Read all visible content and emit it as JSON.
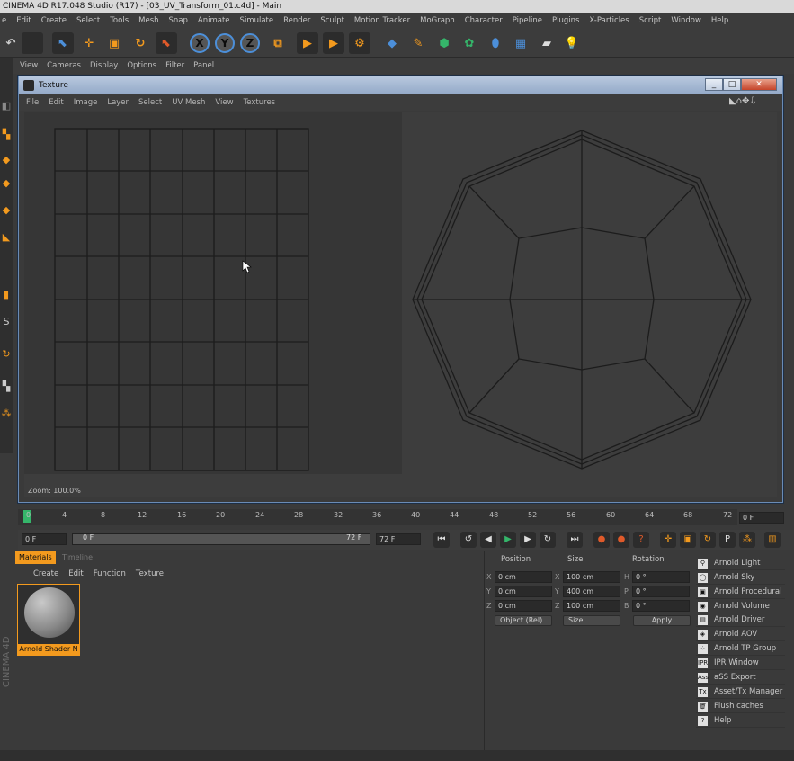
{
  "app": {
    "title": "CINEMA 4D R17.048 Studio (R17) - [03_UV_Transform_01.c4d] - Main",
    "brand": "CINEMA 4D"
  },
  "menubar": [
    "e",
    "Edit",
    "Create",
    "Select",
    "Tools",
    "Mesh",
    "Snap",
    "Animate",
    "Simulate",
    "Render",
    "Sculpt",
    "Motion Tracker",
    "MoGraph",
    "Character",
    "Pipeline",
    "Plugins",
    "X-Particles",
    "Script",
    "Window",
    "Help"
  ],
  "viewport_menu": [
    "View",
    "Cameras",
    "Display",
    "Options",
    "Filter",
    "Panel"
  ],
  "texture_window": {
    "title": "Texture",
    "menu": [
      "File",
      "Edit",
      "Image",
      "Layer",
      "Select",
      "UV Mesh",
      "View",
      "Textures"
    ],
    "zoom": "Zoom: 100.0%"
  },
  "timeline": {
    "ticks": [
      "0",
      "4",
      "8",
      "12",
      "16",
      "20",
      "24",
      "28",
      "32",
      "36",
      "40",
      "44",
      "48",
      "52",
      "56",
      "60",
      "64",
      "68",
      "72"
    ],
    "end_frame": "0 F"
  },
  "transport": {
    "current": "0 F",
    "start": "0 F",
    "end": "72 F",
    "max": "72 F"
  },
  "materials": {
    "tabs": [
      "Materials",
      "Timeline"
    ],
    "menu": [
      "Create",
      "Edit",
      "Function",
      "Texture"
    ],
    "items": [
      {
        "name": "Arnold Shader N"
      }
    ]
  },
  "attributes": {
    "headers": [
      "Position",
      "Size",
      "Rotation"
    ],
    "rows": [
      {
        "axis": "X",
        "pos": "0 cm",
        "size_axis": "X",
        "size": "100 cm",
        "rot_axis": "H",
        "rot": "0 °"
      },
      {
        "axis": "Y",
        "pos": "0 cm",
        "size_axis": "Y",
        "size": "400 cm",
        "rot_axis": "P",
        "rot": "0 °"
      },
      {
        "axis": "Z",
        "pos": "0 cm",
        "size_axis": "Z",
        "size": "100 cm",
        "rot_axis": "B",
        "rot": "0 °"
      }
    ],
    "coord_mode": "Object (Rel)",
    "size_mode": "Size",
    "apply": "Apply"
  },
  "arnold_menu": [
    {
      "icon": "lightbulb-icon",
      "glyph": "⚲",
      "label": "Arnold Light"
    },
    {
      "icon": "sky-icon",
      "glyph": "◯",
      "label": "Arnold Sky"
    },
    {
      "icon": "procedural-icon",
      "glyph": "▣",
      "label": "Arnold Procedural"
    },
    {
      "icon": "volume-icon",
      "glyph": "◉",
      "label": "Arnold Volume"
    },
    {
      "icon": "driver-icon",
      "glyph": "▤",
      "label": "Arnold Driver"
    },
    {
      "icon": "aov-icon",
      "glyph": "◈",
      "label": "Arnold AOV"
    },
    {
      "icon": "tp-group-icon",
      "glyph": "⁘",
      "label": "Arnold TP Group"
    },
    {
      "icon": "ipr-icon",
      "glyph": "IPR",
      "label": "IPR Window"
    },
    {
      "icon": "ass-icon",
      "glyph": "Ass",
      "label": "aSS Export"
    },
    {
      "icon": "tx-icon",
      "glyph": "Tx",
      "label": "Asset/Tx Manager"
    },
    {
      "icon": "trash-icon",
      "glyph": "🗑",
      "label": "Flush caches"
    },
    {
      "icon": "help-icon",
      "glyph": "?",
      "label": "Help"
    }
  ]
}
